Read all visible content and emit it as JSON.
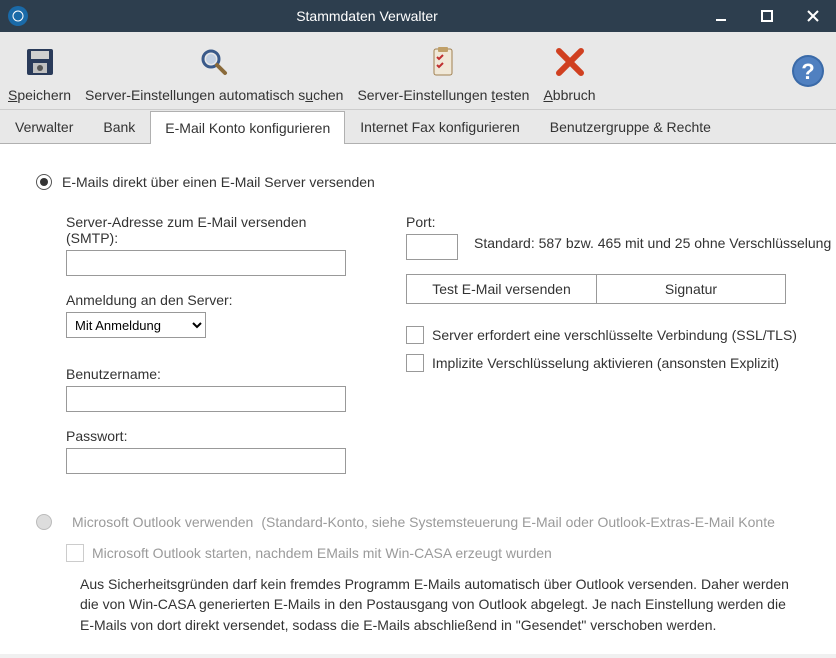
{
  "window": {
    "title": "Stammdaten Verwalter"
  },
  "toolbar": {
    "save": "Speichern",
    "autoSearch": "Server-Einstellungen automatisch suchen",
    "testSettings": "Server-Einstellungen testen",
    "abort": "Abbruch"
  },
  "tabs": {
    "verwalter": "Verwalter",
    "bank": "Bank",
    "email": "E-Mail Konto konfigurieren",
    "fax": "Internet Fax konfigurieren",
    "group": "Benutzergruppe & Rechte"
  },
  "form": {
    "radioDirect": "E-Mails direkt über einen E-Mail Server versenden",
    "smtpLabel": "Server-Adresse zum E-Mail versenden (SMTP):",
    "smtpValue": "",
    "loginLabel": "Anmeldung an den Server:",
    "loginSelected": "Mit Anmeldung",
    "userLabel": "Benutzername:",
    "userValue": "",
    "passLabel": "Passwort:",
    "passValue": "",
    "portLabel": "Port:",
    "portValue": "",
    "portHint": "Standard: 587 bzw. 465 mit und 25 ohne Verschlüsselung",
    "btnTest": "Test E-Mail versenden",
    "btnSignature": "Signatur",
    "chkSSL": "Server erfordert eine verschlüsselte Verbindung (SSL/TLS)",
    "chkImplicit": "Implizite Verschlüsselung aktivieren (ansonsten Explizit)",
    "radioOutlook": "Microsoft Outlook verwenden",
    "radioOutlookExtra": "(Standard-Konto, siehe Systemsteuerung E-Mail oder Outlook-Extras-E-Mail Konte",
    "chkOutlookStart": "Microsoft Outlook starten, nachdem EMails mit Win-CASA erzeugt wurden",
    "outlookDesc": "Aus Sicherheitsgründen darf kein fremdes Programm E-Mails automatisch über Outlook versenden. Daher werden die von Win-CASA generierten E-Mails in den Postausgang von Outlook abgelegt. Je nach Einstellung werden die E-Mails von dort direkt versendet, sodass die E-Mails abschließend in \"Gesendet\" verschoben werden."
  }
}
